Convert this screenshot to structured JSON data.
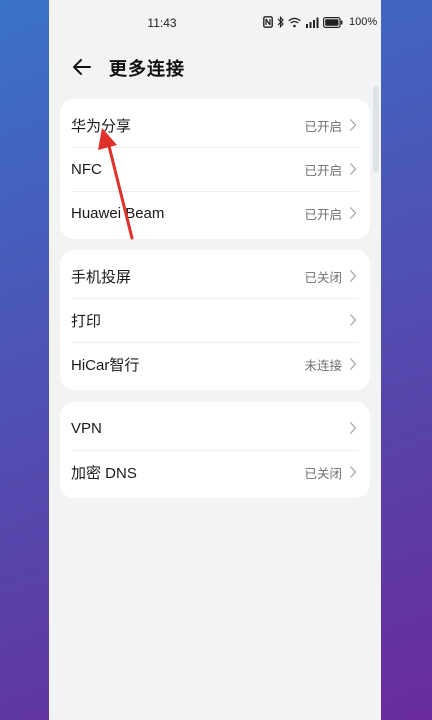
{
  "status_bar": {
    "time": "11:43",
    "battery_text": "100%",
    "icons": [
      "nfc-icon",
      "bluetooth-icon",
      "wifi-icon",
      "signal-icon",
      "battery-icon"
    ]
  },
  "header": {
    "back_icon": "back-arrow-icon",
    "title": "更多连接"
  },
  "groups": [
    {
      "rows": [
        {
          "label": "华为分享",
          "value": "已开启"
        },
        {
          "label": "NFC",
          "value": "已开启"
        },
        {
          "label": "Huawei Beam",
          "value": "已开启"
        }
      ]
    },
    {
      "rows": [
        {
          "label": "手机投屏",
          "value": "已关闭"
        },
        {
          "label": "打印",
          "value": ""
        },
        {
          "label": "HiCar智行",
          "value": "未连接"
        }
      ]
    },
    {
      "rows": [
        {
          "label": "VPN",
          "value": ""
        },
        {
          "label": "加密 DNS",
          "value": "已关闭"
        }
      ]
    }
  ],
  "colors": {
    "annotation_arrow": "#e0302a",
    "card_background": "#ffffff",
    "page_background": "#f1f3f5"
  }
}
